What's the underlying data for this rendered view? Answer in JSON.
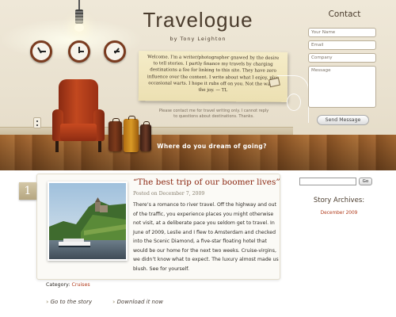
{
  "header": {
    "title": "Travelogue",
    "byline": "by Tony Leighton",
    "intro_note": "Welcome. I'm a writer/photographer gnawed by the desire to tell stories. I partly finance my travels by charging destinations a fee for linking to this site. They have zero influence over the content. I write about what I enjoy, plus occasional warts. I hope it rubs off on you. Not the warts, the joy. — TL",
    "contact_note": "Please contact me for travel writing only. I cannot reply to questions about destinations. Thanks.",
    "tagline": "Where do you dream of going?"
  },
  "contact_form": {
    "heading": "Contact",
    "name_placeholder": "Your Name",
    "email_placeholder": "Email",
    "company_placeholder": "Company",
    "message_placeholder": "Message",
    "send_label": "Send Message"
  },
  "post": {
    "number": "1",
    "title": "“The best trip of our boomer lives”",
    "date": "Posted on December 7, 2009",
    "body": "There’s a romance to river travel. Off the highway and out of the traffic, you experience places you might otherwise not visit, at a deliberate pace you seldom get to travel. In June of 2009, Leslie and I flew to Amsterdam and checked into the Scenic Diamond, a five-star floating hotel that would be our home for the next two weeks. Cruise-virgins, we didn’t know what to expect. The luxury almost made us blush. See for yourself.",
    "category_label": "Category:",
    "category_value": "Cruises",
    "go_label": "Go to the story",
    "download_label": "Download it now"
  },
  "sidebar": {
    "search_button": "Go",
    "archives_heading": "Story Archives:",
    "archive_link": "December 2009"
  }
}
